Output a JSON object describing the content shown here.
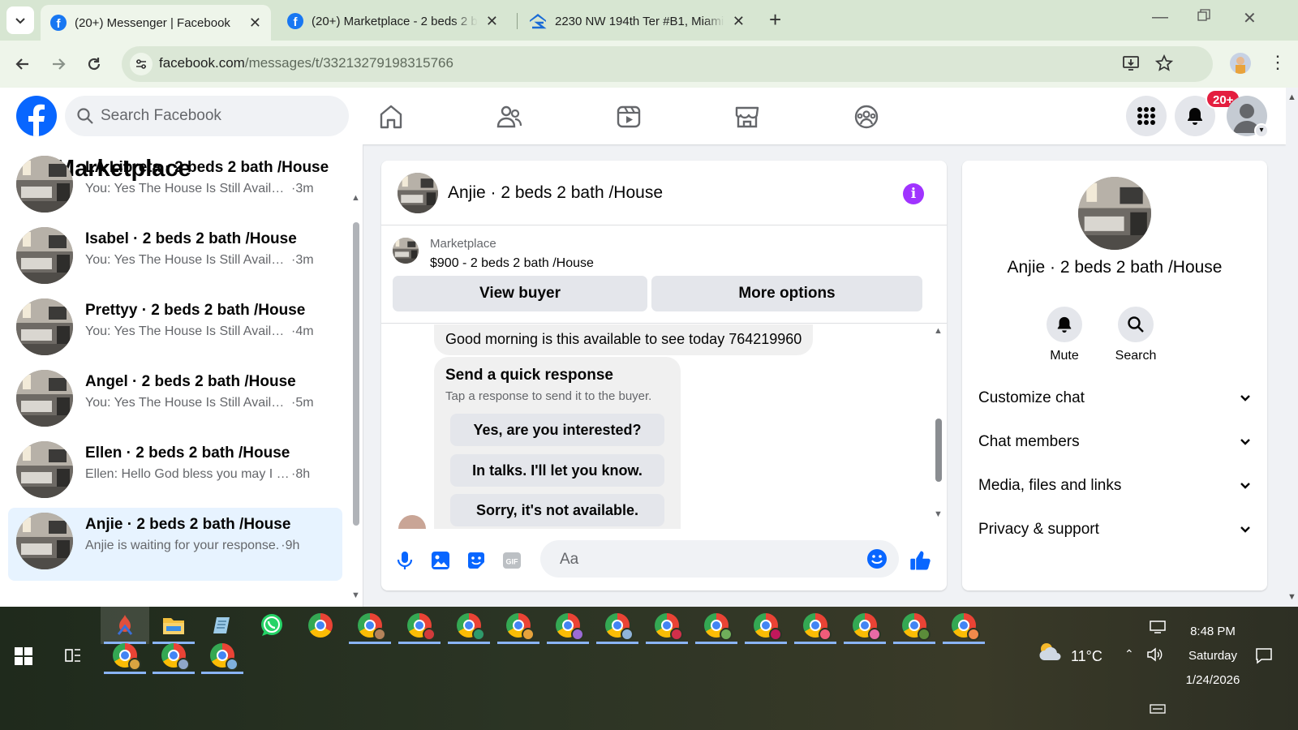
{
  "browser": {
    "tabs": [
      {
        "title": "(20+) Messenger | Facebook",
        "active": true
      },
      {
        "title": "(20+) Marketplace - 2 beds 2 b",
        "active": false
      },
      {
        "title": "2230 NW 194th Ter #B1, Miami",
        "active": false
      }
    ],
    "url_host": "facebook.com",
    "url_path": "/messages/t/33213279198315766"
  },
  "fb_header": {
    "search_placeholder": "Search Facebook",
    "notification_badge": "20+"
  },
  "left_panel": {
    "title": "Marketplace",
    "conversations": [
      {
        "name": "LA Libreta · 2 beds 2 bath /House",
        "snippet": "You: Yes The House Is Still Available",
        "time": "·3m",
        "active": false
      },
      {
        "name": "Isabel · 2 beds 2 bath /House",
        "snippet": "You: Yes The House Is Still Available",
        "time": "·3m",
        "active": false
      },
      {
        "name": "Prettyy · 2 beds 2 bath /House",
        "snippet": "You: Yes The House Is Still Available",
        "time": "·4m",
        "active": false
      },
      {
        "name": "Angel · 2 beds 2 bath /House",
        "snippet": "You: Yes The House Is Still Available",
        "time": "·5m",
        "active": false
      },
      {
        "name": "Ellen · 2 beds 2 bath /House",
        "snippet": "Ellen: Hello God bless you may I pl...",
        "time": "·8h",
        "active": false
      },
      {
        "name": "Anjie · 2 beds 2 bath /House",
        "snippet": "Anjie is waiting for your response.",
        "time": "·9h",
        "active": true
      }
    ]
  },
  "chat": {
    "title": "Anjie · 2 beds 2 bath /House",
    "listing_label": "Marketplace",
    "listing_price": "$900 - 2 beds 2 bath /House",
    "view_buyer_label": "View buyer",
    "more_options_label": "More options",
    "message": "Good morning is this available to see today 764219960",
    "quick_title": "Send a quick response",
    "quick_subtitle": "Tap a response to send it to the buyer.",
    "quick_options": [
      "Yes, are you interested?",
      "In talks. I'll let you know.",
      "Sorry, it's not available."
    ],
    "composer_placeholder": "Aa"
  },
  "info_panel": {
    "name": "Anjie · 2 beds 2 bath /House",
    "mute_label": "Mute",
    "search_label": "Search",
    "rows": [
      "Customize chat",
      "Chat members",
      "Media, files and links",
      "Privacy & support"
    ]
  },
  "taskbar": {
    "temperature": "11°C",
    "time": "8:48 PM",
    "day": "Saturday",
    "date": "1/24/2026"
  },
  "colors": {
    "fb_blue": "#0866ff",
    "active_conversation": "#e7f3ff",
    "info_purple": "#a033ff",
    "badge_red": "#e41e3f"
  }
}
